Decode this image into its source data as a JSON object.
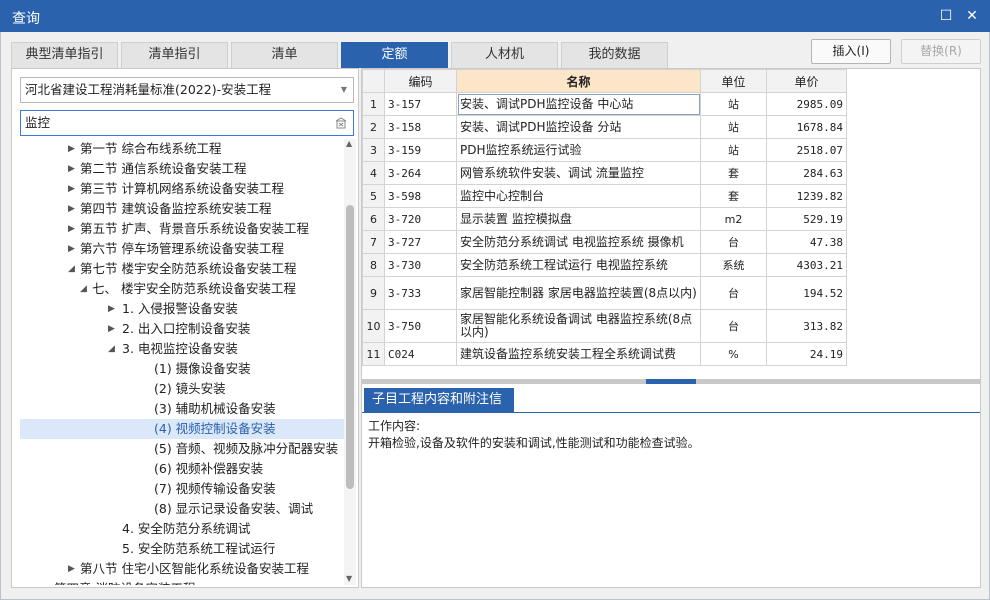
{
  "window": {
    "title": "查询",
    "max_glyph": "☐",
    "close_glyph": "✕"
  },
  "tabs": [
    "典型清单指引",
    "清单指引",
    "清单",
    "定额",
    "人材机",
    "我的数据"
  ],
  "active_tab_index": 3,
  "actions": {
    "insert": "插入(I)",
    "replace": "替换(R)"
  },
  "left": {
    "standard_select": "河北省建设工程消耗量标准(2022)-安装工程",
    "search_value": "监控",
    "tree": [
      {
        "label": "第一节  综合布线系统工程",
        "level": 0,
        "arrow": "right"
      },
      {
        "label": "第二节  通信系统设备安装工程",
        "level": 0,
        "arrow": "right"
      },
      {
        "label": "第三节  计算机网络系统设备安装工程",
        "level": 0,
        "arrow": "right"
      },
      {
        "label": "第四节  建筑设备监控系统安装工程",
        "level": 0,
        "arrow": "right"
      },
      {
        "label": "第五节  扩声、背景音乐系统设备安装工程",
        "level": 0,
        "arrow": "right"
      },
      {
        "label": "第六节  停车场管理系统设备安装工程",
        "level": 0,
        "arrow": "right"
      },
      {
        "label": "第七节  楼宇安全防范系统设备安装工程",
        "level": 0,
        "arrow": "down"
      },
      {
        "label": "七、  楼宇安全防范系统设备安装工程",
        "level": 1,
        "arrow": "down"
      },
      {
        "label": "1. 入侵报警设备安装",
        "level": 2,
        "arrow": "right"
      },
      {
        "label": "2. 出入口控制设备安装",
        "level": 2,
        "arrow": "right"
      },
      {
        "label": "3. 电视监控设备安装",
        "level": 2,
        "arrow": "down"
      },
      {
        "label": "(1) 摄像设备安装",
        "level": 3,
        "arrow": ""
      },
      {
        "label": "(2) 镜头安装",
        "level": 3,
        "arrow": ""
      },
      {
        "label": "(3) 辅助机械设备安装",
        "level": 3,
        "arrow": ""
      },
      {
        "label": "(4) 视频控制设备安装",
        "level": 3,
        "arrow": "",
        "selected": true
      },
      {
        "label": "(5) 音频、视频及脉冲分配器安装",
        "level": 3,
        "arrow": ""
      },
      {
        "label": "(6) 视频补偿器安装",
        "level": 3,
        "arrow": ""
      },
      {
        "label": "(7) 视频传输设备安装",
        "level": 3,
        "arrow": ""
      },
      {
        "label": "(8) 显示记录设备安装、调试",
        "level": 3,
        "arrow": ""
      },
      {
        "label": "4. 安全防范分系统调试",
        "level": 2,
        "arrow": ""
      },
      {
        "label": "5. 安全防范系统工程试运行",
        "level": 2,
        "arrow": ""
      },
      {
        "label": "第八节  住宅小区智能化系统设备安装工程",
        "level": 0,
        "arrow": "right"
      },
      {
        "label": "第四章  消防设备安装工程",
        "level": -1,
        "arrow": ""
      }
    ]
  },
  "grid": {
    "headers": {
      "code": "编码",
      "name": "名称",
      "unit": "单位",
      "price": "单价"
    },
    "rows": [
      {
        "n": "1",
        "code": "3-157",
        "name": "安装、调试PDH监控设备 中心站",
        "unit": "站",
        "price": "2985.09"
      },
      {
        "n": "2",
        "code": "3-158",
        "name": "安装、调试PDH监控设备 分站",
        "unit": "站",
        "price": "1678.84"
      },
      {
        "n": "3",
        "code": "3-159",
        "name": "PDH监控系统运行试验",
        "unit": "站",
        "price": "2518.07"
      },
      {
        "n": "4",
        "code": "3-264",
        "name": "网管系统软件安装、调试 流量监控",
        "unit": "套",
        "price": "284.63"
      },
      {
        "n": "5",
        "code": "3-598",
        "name": "监控中心控制台",
        "unit": "套",
        "price": "1239.82"
      },
      {
        "n": "6",
        "code": "3-720",
        "name": "显示装置 监控模拟盘",
        "unit": "m2",
        "price": "529.19"
      },
      {
        "n": "7",
        "code": "3-727",
        "name": "安全防范分系统调试 电视监控系统 摄像机",
        "unit": "台",
        "price": "47.38"
      },
      {
        "n": "8",
        "code": "3-730",
        "name": "安全防范系统工程试运行 电视监控系统",
        "unit": "系统",
        "price": "4303.21"
      },
      {
        "n": "9",
        "code": "3-733",
        "name": "家居智能控制器 家居电器监控装置(8点以内)",
        "unit": "台",
        "price": "194.52"
      },
      {
        "n": "10",
        "code": "3-750",
        "name": "家居智能化系统设备调试 电器监控系统(8点以内)",
        "unit": "台",
        "price": "313.82"
      },
      {
        "n": "11",
        "code": "C024",
        "name": "建筑设备监控系统安装工程全系统调试费",
        "unit": "%",
        "price": "24.19"
      }
    ]
  },
  "info": {
    "tab_label": "子目工程内容和附注信息",
    "content_label": "工作内容:",
    "content_text": "开箱检验,设备及软件的安装和调试,性能测试和功能检查试验。"
  }
}
